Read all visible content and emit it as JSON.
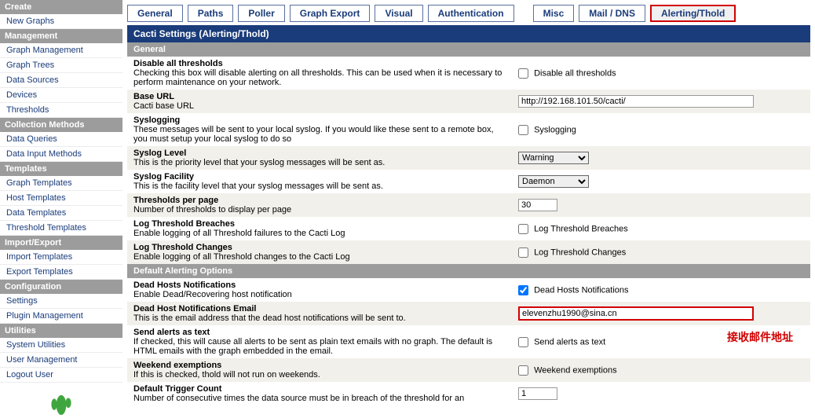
{
  "sidebar": {
    "groups": [
      {
        "title": "Create",
        "items": [
          {
            "label": "New Graphs"
          }
        ]
      },
      {
        "title": "Management",
        "items": [
          {
            "label": "Graph Management"
          },
          {
            "label": "Graph Trees"
          },
          {
            "label": "Data Sources"
          },
          {
            "label": "Devices"
          },
          {
            "label": "Thresholds"
          }
        ]
      },
      {
        "title": "Collection Methods",
        "items": [
          {
            "label": "Data Queries"
          },
          {
            "label": "Data Input Methods"
          }
        ]
      },
      {
        "title": "Templates",
        "items": [
          {
            "label": "Graph Templates"
          },
          {
            "label": "Host Templates"
          },
          {
            "label": "Data Templates"
          },
          {
            "label": "Threshold Templates"
          }
        ]
      },
      {
        "title": "Import/Export",
        "items": [
          {
            "label": "Import Templates"
          },
          {
            "label": "Export Templates"
          }
        ]
      },
      {
        "title": "Configuration",
        "items": [
          {
            "label": "Settings"
          },
          {
            "label": "Plugin Management"
          }
        ]
      },
      {
        "title": "Utilities",
        "items": [
          {
            "label": "System Utilities"
          },
          {
            "label": "User Management"
          },
          {
            "label": "Logout User"
          }
        ]
      }
    ]
  },
  "tabs": [
    {
      "label": "General"
    },
    {
      "label": "Paths"
    },
    {
      "label": "Poller"
    },
    {
      "label": "Graph Export"
    },
    {
      "label": "Visual"
    },
    {
      "label": "Authentication"
    },
    {
      "label": "Misc"
    },
    {
      "label": "Mail / DNS"
    },
    {
      "label": "Alerting/Thold"
    }
  ],
  "titlebar": "Cacti Settings (Alerting/Thold)",
  "sections": {
    "general": "General",
    "default_alerting": "Default Alerting Options"
  },
  "rows": {
    "disable_all": {
      "label": "Disable all thresholds",
      "help": "Checking this box will disable alerting on all thresholds. This can be used when it is necessary to perform maintenance on your network.",
      "cb_label": "Disable all thresholds",
      "checked": false
    },
    "base_url": {
      "label": "Base URL",
      "help": "Cacti base URL",
      "value": "http://192.168.101.50/cacti/"
    },
    "syslogging": {
      "label": "Syslogging",
      "help": "These messages will be sent to your local syslog. If you would like these sent to a remote box, you must setup your local syslog to do so",
      "cb_label": "Syslogging",
      "checked": false
    },
    "syslog_level": {
      "label": "Syslog Level",
      "help": "This is the priority level that your syslog messages will be sent as.",
      "value": "Warning"
    },
    "syslog_facility": {
      "label": "Syslog Facility",
      "help": "This is the facility level that your syslog messages will be sent as.",
      "value": "Daemon"
    },
    "per_page": {
      "label": "Thresholds per page",
      "help": "Number of thresholds to display per page",
      "value": "30"
    },
    "log_breaches": {
      "label": "Log Threshold Breaches",
      "help": "Enable logging of all Threshold failures to the Cacti Log",
      "cb_label": "Log Threshold Breaches",
      "checked": false
    },
    "log_changes": {
      "label": "Log Threshold Changes",
      "help": "Enable logging of all Threshold changes to the Cacti Log",
      "cb_label": "Log Threshold Changes",
      "checked": false
    },
    "dead_hosts": {
      "label": "Dead Hosts Notifications",
      "help": "Enable Dead/Recovering host notification",
      "cb_label": "Dead Hosts Notifications",
      "checked": true
    },
    "dead_email": {
      "label": "Dead Host Notifications Email",
      "help": "This is the email address that the dead host notifications will be sent to.",
      "value": "elevenzhu1990@sina.cn"
    },
    "alerts_text": {
      "label": "Send alerts as text",
      "help": "If checked, this will cause all alerts to be sent as plain text emails with no graph. The default is HTML emails with the graph embedded in the email.",
      "cb_label": "Send alerts as text",
      "checked": false
    },
    "weekend": {
      "label": "Weekend exemptions",
      "help": "If this is checked, thold will not run on weekends.",
      "cb_label": "Weekend exemptions",
      "checked": false
    },
    "trigger_count": {
      "label": "Default Trigger Count",
      "help": "Number of consecutive times the data source must be in breach of the threshold for an",
      "value": "1"
    }
  },
  "annotation": "接收邮件地址"
}
